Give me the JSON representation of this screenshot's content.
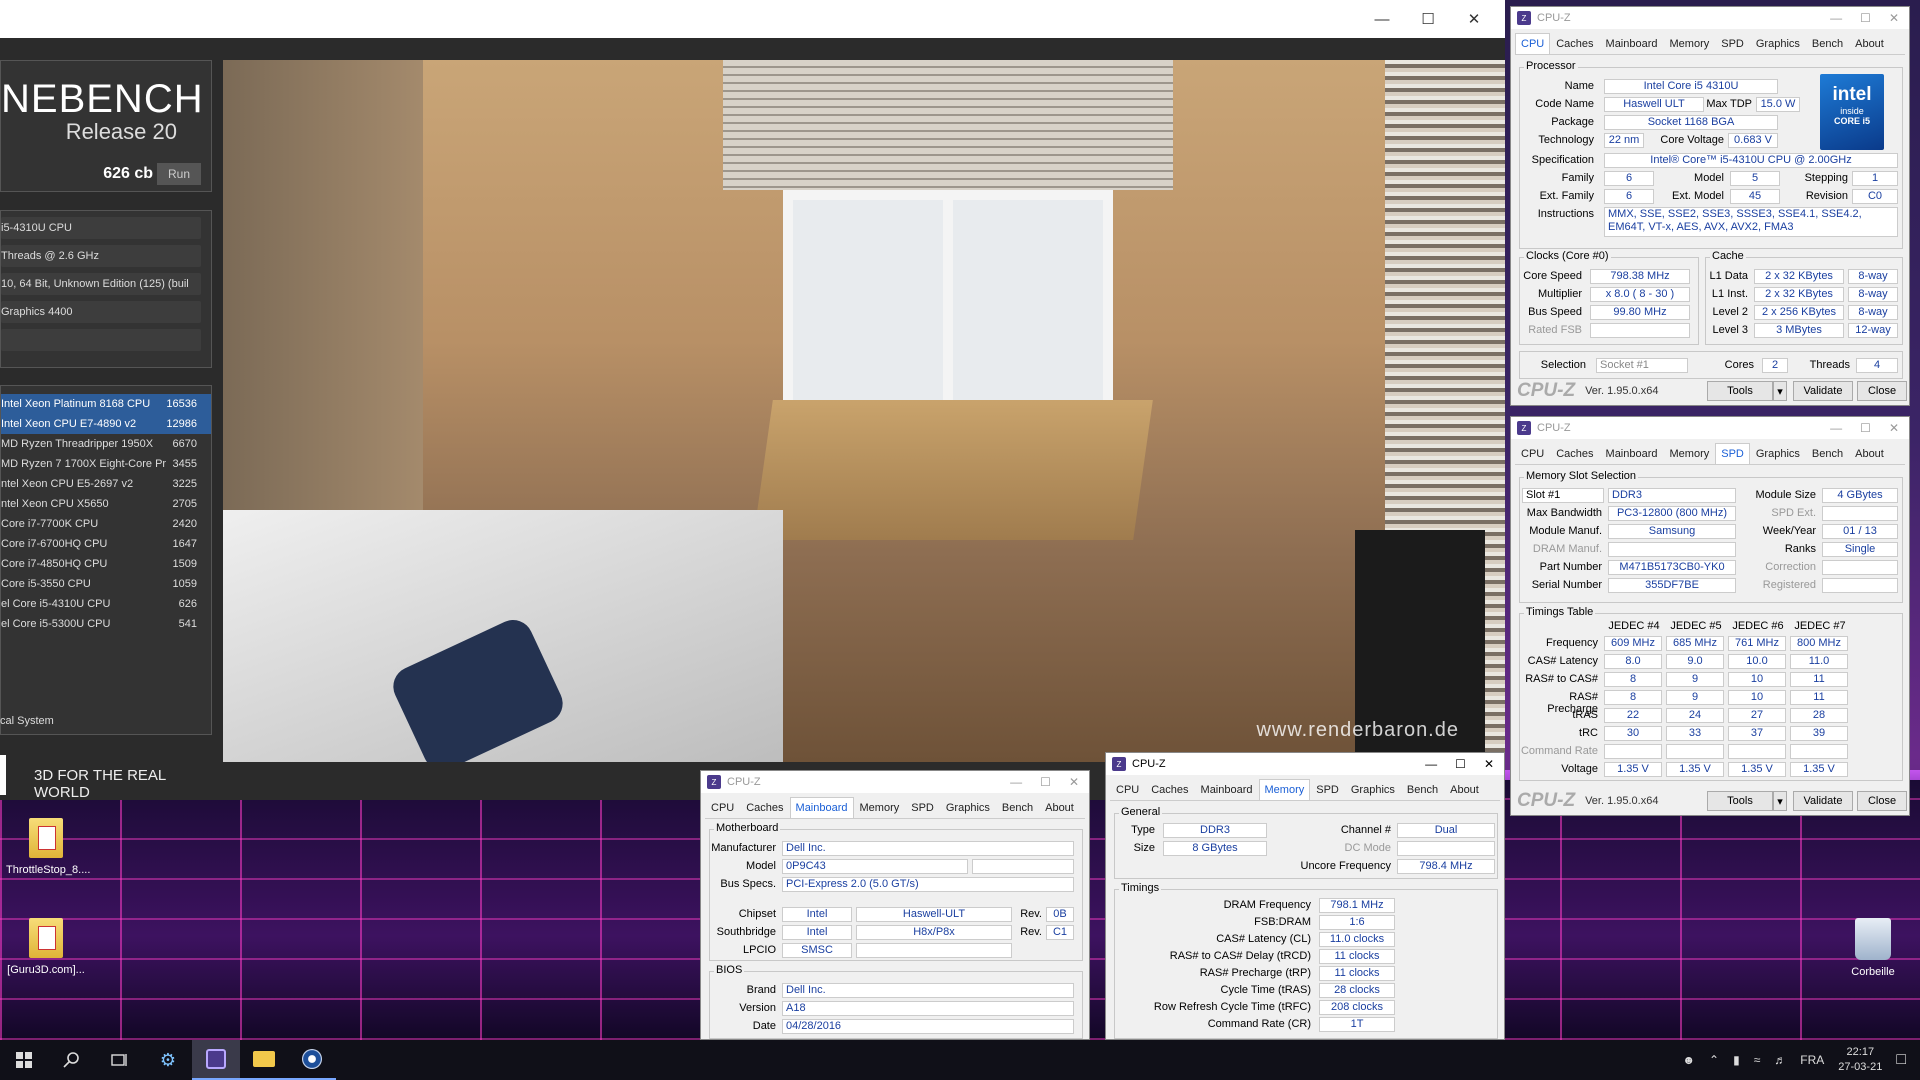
{
  "cinebench": {
    "brand": "NEBENCH",
    "release": "Release 20",
    "score": "626 cb",
    "run_label": "Run",
    "info": [
      "i5-4310U CPU",
      "Threads @ 2.6 GHz",
      "10, 64 Bit, Unknown Edition (125) (buil",
      "Graphics 4400",
      ""
    ],
    "ranking": [
      {
        "name": "Intel Xeon Platinum 8168 CPU",
        "score": "16536",
        "hl": true
      },
      {
        "name": "Intel Xeon CPU E7-4890 v2",
        "score": "12986",
        "hl": true
      },
      {
        "name": "MD Ryzen Threadripper 1950X",
        "score": "6670",
        "hl": false
      },
      {
        "name": "MD Ryzen 7 1700X Eight-Core Pr",
        "score": "3455",
        "hl": false
      },
      {
        "name": "ntel Xeon CPU E5-2697 v2",
        "score": "3225",
        "hl": false
      },
      {
        "name": "ntel Xeon CPU X5650",
        "score": "2705",
        "hl": false
      },
      {
        "name": "Core i7-7700K CPU",
        "score": "2420",
        "hl": false
      },
      {
        "name": "Core i7-6700HQ CPU",
        "score": "1647",
        "hl": false
      },
      {
        "name": "Core i7-4850HQ CPU",
        "score": "1509",
        "hl": false
      },
      {
        "name": "Core i5-3550 CPU",
        "score": "1059",
        "hl": false
      },
      {
        "name": "el Core i5-4310U CPU",
        "score": "626",
        "hl": false
      },
      {
        "name": "el Core i5-5300U CPU",
        "score": "541",
        "hl": false
      }
    ],
    "local_label": "cal System",
    "tagline": "3D FOR THE REAL WORLD",
    "watermark": "www.renderbaron.de"
  },
  "cpuz_common": {
    "title": "CPU-Z",
    "tabs": [
      "CPU",
      "Caches",
      "Mainboard",
      "Memory",
      "SPD",
      "Graphics",
      "Bench",
      "About"
    ],
    "logo": "CPU-Z",
    "version": "Ver. 1.95.0.x64",
    "tools": "Tools",
    "validate": "Validate",
    "close": "Close"
  },
  "cpu_tab": {
    "processor_label": "Processor",
    "name_l": "Name",
    "name": "Intel Core i5 4310U",
    "codename_l": "Code Name",
    "codename": "Haswell ULT",
    "maxtdp_l": "Max TDP",
    "maxtdp": "15.0 W",
    "package_l": "Package",
    "package": "Socket 1168 BGA",
    "tech_l": "Technology",
    "tech": "22 nm",
    "corev_l": "Core Voltage",
    "corev": "0.683 V",
    "spec_l": "Specification",
    "spec": "Intel® Core™ i5-4310U CPU @ 2.00GHz",
    "family_l": "Family",
    "family": "6",
    "model_l": "Model",
    "model": "5",
    "stepping_l": "Stepping",
    "stepping": "1",
    "extfam_l": "Ext. Family",
    "extfam": "6",
    "extmod_l": "Ext. Model",
    "extmod": "45",
    "rev_l": "Revision",
    "rev": "C0",
    "instr_l": "Instructions",
    "instr": "MMX, SSE, SSE2, SSE3, SSSE3, SSE4.1, SSE4.2, EM64T, VT-x, AES, AVX, AVX2, FMA3",
    "clocks_label": "Clocks (Core #0)",
    "cspeed_l": "Core Speed",
    "cspeed": "798.38 MHz",
    "mult_l": "Multiplier",
    "mult": "x 8.0 ( 8 - 30 )",
    "bus_l": "Bus Speed",
    "bus": "99.80 MHz",
    "fsb_l": "Rated FSB",
    "fsb": "",
    "cache_label": "Cache",
    "l1d_l": "L1 Data",
    "l1d": "2 x 32 KBytes",
    "l1d_w": "8-way",
    "l1i_l": "L1 Inst.",
    "l1i": "2 x 32 KBytes",
    "l1i_w": "8-way",
    "l2_l": "Level 2",
    "l2": "2 x 256 KBytes",
    "l2_w": "8-way",
    "l3_l": "Level 3",
    "l3": "3 MBytes",
    "l3_w": "12-way",
    "sel_l": "Selection",
    "sel": "Socket #1",
    "cores_l": "Cores",
    "cores": "2",
    "threads_l": "Threads",
    "threads": "4",
    "intel_logo": "intel",
    "intel_inside": "inside",
    "intel_core": "CORE i5"
  },
  "spd_tab": {
    "slotsel_label": "Memory Slot Selection",
    "slot": "Slot #1",
    "type": "DDR3",
    "modsize_l": "Module Size",
    "modsize": "4 GBytes",
    "maxbw_l": "Max Bandwidth",
    "maxbw": "PC3-12800 (800 MHz)",
    "spdext_l": "SPD Ext.",
    "manuf_l": "Module Manuf.",
    "manuf": "Samsung",
    "week_l": "Week/Year",
    "week": "01 / 13",
    "dram_l": "DRAM Manuf.",
    "ranks_l": "Ranks",
    "ranks": "Single",
    "part_l": "Part Number",
    "part": "M471B5173CB0-YK0",
    "corr_l": "Correction",
    "serial_l": "Serial Number",
    "serial": "355DF7BE",
    "reg_l": "Registered",
    "timings_label": "Timings Table",
    "jedec": [
      "JEDEC #4",
      "JEDEC #5",
      "JEDEC #6",
      "JEDEC #7"
    ],
    "rows": [
      {
        "label": "Frequency",
        "vals": [
          "609 MHz",
          "685 MHz",
          "761 MHz",
          "800 MHz"
        ]
      },
      {
        "label": "CAS# Latency",
        "vals": [
          "8.0",
          "9.0",
          "10.0",
          "11.0"
        ]
      },
      {
        "label": "RAS# to CAS#",
        "vals": [
          "8",
          "9",
          "10",
          "11"
        ]
      },
      {
        "label": "RAS# Precharge",
        "vals": [
          "8",
          "9",
          "10",
          "11"
        ]
      },
      {
        "label": "tRAS",
        "vals": [
          "22",
          "24",
          "27",
          "28"
        ]
      },
      {
        "label": "tRC",
        "vals": [
          "30",
          "33",
          "37",
          "39"
        ]
      },
      {
        "label": "Command Rate",
        "vals": [
          "",
          "",
          "",
          ""
        ],
        "dim": true
      },
      {
        "label": "Voltage",
        "vals": [
          "1.35 V",
          "1.35 V",
          "1.35 V",
          "1.35 V"
        ]
      }
    ]
  },
  "mb_tab": {
    "mb_label": "Motherboard",
    "manuf_l": "Manufacturer",
    "manuf": "Dell Inc.",
    "model_l": "Model",
    "model": "0P9C43",
    "bus_l": "Bus Specs.",
    "bus": "PCI-Express 2.0 (5.0 GT/s)",
    "chipset_l": "Chipset",
    "chipset_v": "Intel",
    "chipset_n": "Haswell-ULT",
    "chipset_rev_l": "Rev.",
    "chipset_rev": "0B",
    "south_l": "Southbridge",
    "south_v": "Intel",
    "south_n": "H8x/P8x",
    "south_rev_l": "Rev.",
    "south_rev": "C1",
    "lpcio_l": "LPCIO",
    "lpcio": "SMSC",
    "bios_label": "BIOS",
    "brand_l": "Brand",
    "brand": "Dell Inc.",
    "version_l": "Version",
    "version": "A18",
    "date_l": "Date",
    "date": "04/28/2016"
  },
  "mem_tab": {
    "general_label": "General",
    "type_l": "Type",
    "type": "DDR3",
    "channel_l": "Channel #",
    "channel": "Dual",
    "size_l": "Size",
    "size": "8 GBytes",
    "dc_l": "DC Mode",
    "uncore_l": "Uncore Frequency",
    "uncore": "798.4 MHz",
    "timings_label": "Timings",
    "rows": [
      {
        "label": "DRAM Frequency",
        "val": "798.1 MHz"
      },
      {
        "label": "FSB:DRAM",
        "val": "1:6"
      },
      {
        "label": "CAS# Latency (CL)",
        "val": "11.0 clocks"
      },
      {
        "label": "RAS# to CAS# Delay (tRCD)",
        "val": "11 clocks"
      },
      {
        "label": "RAS# Precharge (tRP)",
        "val": "11 clocks"
      },
      {
        "label": "Cycle Time (tRAS)",
        "val": "28 clocks"
      },
      {
        "label": "Row Refresh Cycle Time (tRFC)",
        "val": "208 clocks"
      },
      {
        "label": "Command Rate (CR)",
        "val": "1T"
      }
    ]
  },
  "desktop": {
    "icon1": "ThrottleStop_8....",
    "icon2": "[Guru3D.com]...",
    "bin": "Corbeille"
  },
  "taskbar": {
    "lang": "FRA",
    "time": "22:17",
    "date": "27-03-21"
  }
}
